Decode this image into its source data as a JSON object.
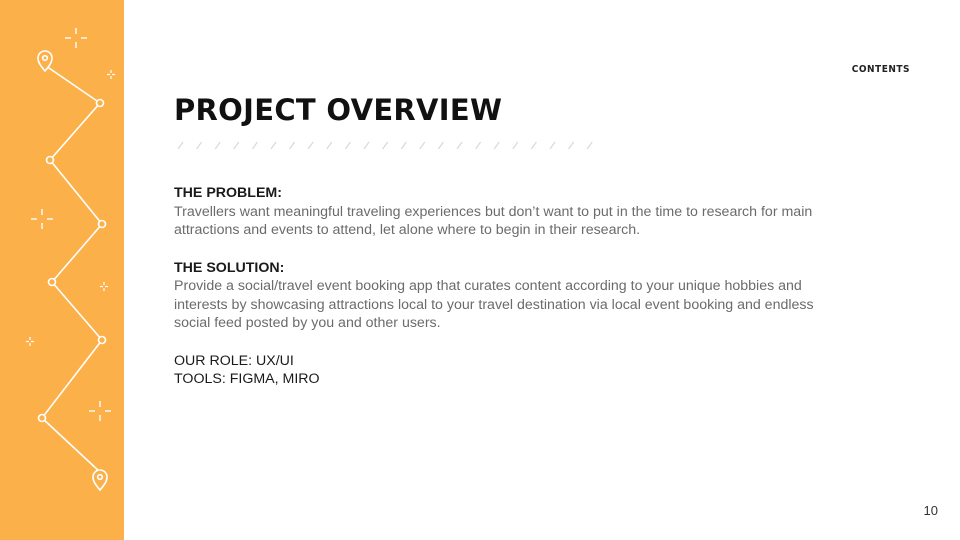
{
  "nav": {
    "contents_label": "CONTENTS"
  },
  "slide": {
    "title": "PROJECT OVERVIEW",
    "problem_heading": "THE PROBLEM:",
    "problem_text": "Travellers want meaningful traveling experiences but don’t want to put in the time to research for main attractions and events to attend, let alone where to begin in their research.",
    "solution_heading": "THE SOLUTION:",
    "solution_text": "Provide a social/travel event booking app that curates content according to your unique hobbies and interests by showcasing attractions local to your travel destination via local event booking and endless social feed posted by you and other users.",
    "role": "OUR ROLE: UX/UI",
    "tools": "TOOLS: FIGMA, MIRO",
    "page_number": "10"
  },
  "theme": {
    "sidebar_color": "#fcb04a",
    "line_color": "#ffffff"
  },
  "icons": [
    "map-pin-icon",
    "sparkle-icon",
    "route-line-icon"
  ]
}
